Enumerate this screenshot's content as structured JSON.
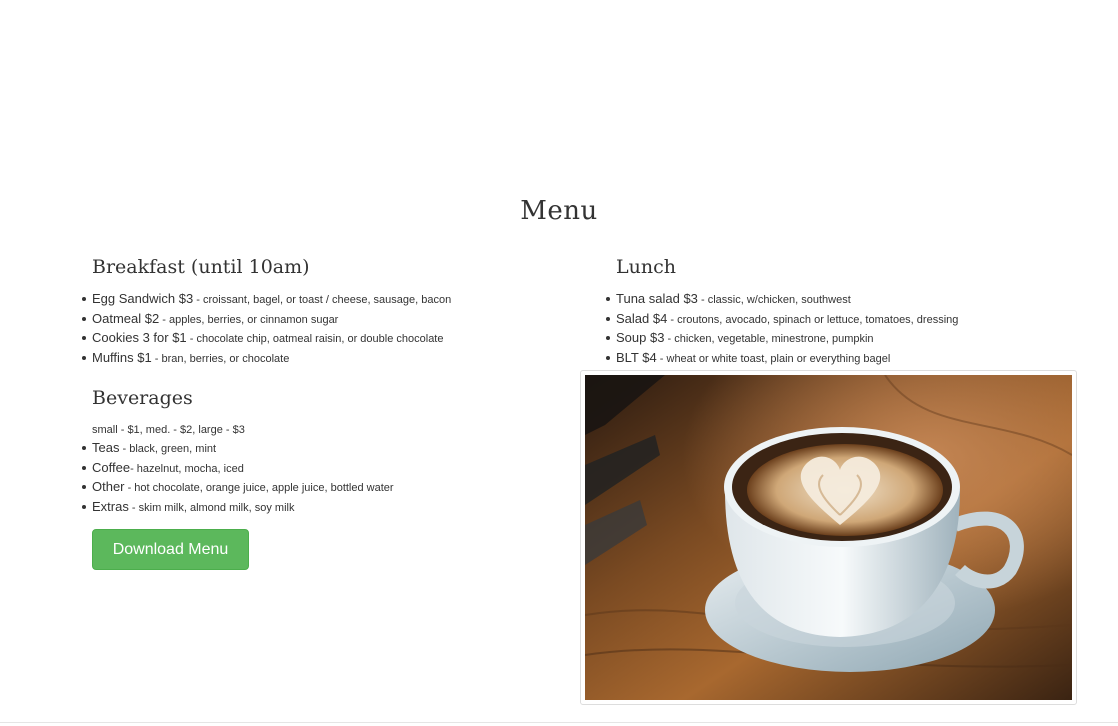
{
  "menu": {
    "title": "Menu"
  },
  "breakfast": {
    "title": "Breakfast (until 10am)",
    "items": [
      {
        "name": "Egg Sandwich $3",
        "desc": " - croissant, bagel, or toast / cheese, sausage, bacon"
      },
      {
        "name": "Oatmeal $2",
        "desc": " - apples, berries, or cinnamon sugar"
      },
      {
        "name": "Cookies 3 for $1",
        "desc": " - chocolate chip, oatmeal raisin, or double chocolate"
      },
      {
        "name": "Muffins $1",
        "desc": " - bran, berries, or chocolate"
      }
    ]
  },
  "lunch": {
    "title": "Lunch",
    "items": [
      {
        "name": "Tuna salad $3",
        "desc": " - classic, w/chicken, southwest"
      },
      {
        "name": "Salad $4",
        "desc": " - croutons, avocado, spinach or lettuce, tomatoes, dressing"
      },
      {
        "name": "Soup $3",
        "desc": " - chicken, vegetable, minestrone, pumpkin"
      },
      {
        "name": "BLT $4",
        "desc": " - wheat or white toast, plain or everything bagel"
      }
    ]
  },
  "beverages": {
    "title": "Beverages",
    "note": "small - $1, med. - $2, large - $3",
    "items": [
      {
        "name": "Teas",
        "desc": " - black, green, mint"
      },
      {
        "name": "Coffee",
        "desc": "- hazelnut, mocha, iced"
      },
      {
        "name": "Other",
        "desc": " - hot chocolate, orange juice, apple juice, bottled water"
      },
      {
        "name": "Extras",
        "desc": " - skim milk, almond milk, soy milk"
      }
    ]
  },
  "download_button": {
    "label": "Download Menu"
  },
  "colors": {
    "button_green": "#5cb85c",
    "text": "#333333"
  },
  "image": {
    "subject": "coffee-cup-latte-art"
  }
}
